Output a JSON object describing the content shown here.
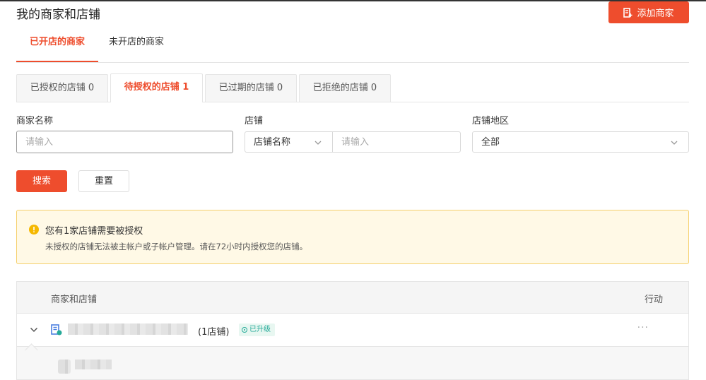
{
  "header": {
    "title": "我的商家和店铺",
    "add_button": "添加商家"
  },
  "main_tabs": [
    {
      "label": "已开店的商家",
      "active": true
    },
    {
      "label": "未开店的商家",
      "active": false
    }
  ],
  "sub_tabs": [
    {
      "label": "已授权的店铺 0",
      "active": false
    },
    {
      "label": "待授权的店铺 1",
      "active": true
    },
    {
      "label": "已过期的店铺 0",
      "active": false
    },
    {
      "label": "已拒绝的店铺 0",
      "active": false
    }
  ],
  "filters": {
    "merchant_name_label": "商家名称",
    "merchant_name_placeholder": "请输入",
    "shop_label": "店铺",
    "shop_field_select": "店铺名称",
    "shop_placeholder": "请输入",
    "region_label": "店铺地区",
    "region_value": "全部"
  },
  "actions": {
    "search": "搜索",
    "reset": "重置"
  },
  "alert": {
    "title": "您有1家店铺需要被授权",
    "message": "未授权的店铺无法被主帐户或子帐户管理。请在72小时内授权您的店铺。"
  },
  "table": {
    "col_merchant_shop": "商家和店铺",
    "col_action": "行动",
    "rows": [
      {
        "shop_count": "(1店铺)",
        "badge": "已升级",
        "more": "···"
      }
    ]
  },
  "colors": {
    "accent": "#ee4d2d",
    "success": "#26aa99",
    "warning_bg": "#fff9e6",
    "warning_border": "#f5d06d"
  }
}
